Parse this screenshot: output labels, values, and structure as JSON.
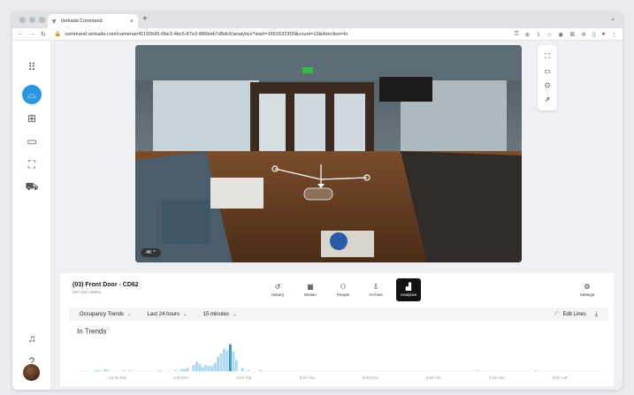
{
  "browser": {
    "tab_title": "Verkada Command",
    "tab_close": "×",
    "new_tab": "+",
    "url": "command.verkada.com/cameras/41192b95-0be3-4bc5-87e3-886beb7d5dc6/analytics?start=1651632300&count=13&direction=In"
  },
  "camera": {
    "title": "(03) Front Door - CD62",
    "site": "WH San Mateo",
    "quality_badge": "4K ^"
  },
  "modes": [
    {
      "label": "History",
      "icon": "↺"
    },
    {
      "label": "Motion",
      "icon": "▦"
    },
    {
      "label": "People",
      "icon": "⚇"
    },
    {
      "label": "Archive",
      "icon": "⇩"
    },
    {
      "label": "Analytics",
      "icon": "▟"
    }
  ],
  "settings": {
    "label": "Settings",
    "icon": "⚙"
  },
  "filters": {
    "trend_type": "Occupancy Trends",
    "time_range": "Last 24 hours",
    "interval": "15 minutes",
    "edit_lines": "Edit Lines"
  },
  "trend": {
    "title": "In Trends",
    "info": "ⓘ"
  },
  "colors": {
    "accent": "#2a96e0",
    "bar": "#a9d6f3",
    "bar_highlight": "#2a96e0"
  },
  "chart_data": {
    "type": "bar",
    "title": "In Trends",
    "x_tick_labels": [
      "12:00 PM",
      "3:00 PM",
      "6:00 PM",
      "9:00 PM",
      "5/4/2022",
      "3:00 AM",
      "6:00 AM",
      "9:00 AM"
    ],
    "values": [
      0,
      0,
      0,
      0,
      0,
      0,
      1,
      1,
      0,
      2,
      1,
      0,
      0,
      0,
      0,
      1,
      0,
      1,
      0,
      0,
      0,
      0,
      0,
      0,
      0,
      0,
      0,
      1,
      0,
      0,
      0,
      0,
      1,
      0,
      2,
      2,
      3,
      0,
      6,
      9,
      7,
      4,
      6,
      5,
      5,
      8,
      14,
      17,
      22,
      20,
      26,
      19,
      11,
      0,
      3,
      0,
      1,
      0,
      0,
      0,
      1,
      0,
      0,
      0,
      0,
      0,
      0,
      0,
      0,
      0,
      0,
      0,
      0,
      0,
      0,
      0,
      0,
      0,
      0,
      0,
      0,
      0,
      0,
      0,
      0,
      0,
      0,
      0,
      0,
      0,
      0,
      0,
      0,
      0,
      0,
      0,
      0,
      0,
      0,
      0,
      0,
      0,
      0,
      0,
      0,
      0,
      0,
      0,
      0,
      0,
      0,
      0,
      0,
      0,
      0,
      0,
      0,
      0,
      0,
      0,
      0,
      0,
      0,
      0,
      0,
      0,
      0,
      0,
      0,
      0,
      0,
      1,
      0,
      0,
      0,
      0,
      0,
      0,
      0,
      0,
      0,
      0,
      0,
      0,
      0,
      0,
      0,
      0,
      0,
      0,
      1,
      0,
      0,
      0,
      0,
      0,
      0,
      0,
      0,
      0,
      0,
      0,
      0,
      0,
      0,
      0,
      0,
      0,
      0,
      0,
      0,
      0
    ],
    "highlight_index": 50,
    "ylim": [
      0,
      30
    ]
  }
}
